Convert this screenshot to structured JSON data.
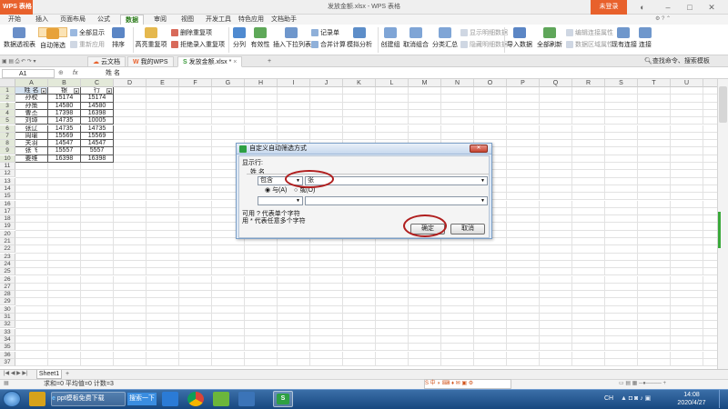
{
  "app": {
    "logo": "WPS 表格",
    "file_title": "发放金额.xlsx - WPS 表格",
    "login": "未登录"
  },
  "menu": [
    "开始",
    "插入",
    "页面布局",
    "公式",
    "数据",
    "审阅",
    "视图",
    "开发工具",
    "特色应用",
    "文档助手"
  ],
  "ribbon": {
    "pivot": "数据透视表",
    "autofilter": "自动筛选",
    "show_all": "全部显示",
    "reapply": "重新应用",
    "sort": "排序",
    "highlight_dup": "高亮重复项",
    "delete_dup": "删除重复项",
    "reject_dup": "拒绝录入重复项",
    "split": "分列",
    "validity": "有效性",
    "dropdown": "插入下拉列表",
    "record": "记录单",
    "merge_calc": "合并计算",
    "simulate": "模拟分析",
    "create_group": "创建组",
    "cancel_group": "取消组合",
    "subtotal": "分类汇总",
    "show_detail": "显示明细数据",
    "hide_detail": "隐藏明细数据",
    "import": "导入数据",
    "refresh_all": "全部刷新",
    "edit_link": "编辑连接属性",
    "data_region": "数据区域属性",
    "existing_conn": "现有连接",
    "connect": "连接"
  },
  "tabs": {
    "cloud": "云文档",
    "mywps": "我的WPS",
    "file": "发放金额.xlsx *",
    "search": "查找命令、搜索模板"
  },
  "formula": {
    "cell_ref": "A1",
    "fx": "fx",
    "value": "姓  名"
  },
  "columns": [
    "A",
    "B",
    "C",
    "D",
    "E",
    "F",
    "G",
    "H",
    "I",
    "J",
    "K",
    "L",
    "M",
    "N",
    "O",
    "P",
    "Q",
    "R",
    "S",
    "T",
    "U",
    "V"
  ],
  "rows": [
    "1",
    "2",
    "3",
    "4",
    "5",
    "6",
    "7",
    "8",
    "9",
    "10",
    "11",
    "12",
    "13",
    "14",
    "15",
    "16",
    "17",
    "18",
    "19",
    "20",
    "21",
    "22",
    "23",
    "24",
    "25",
    "26",
    "27",
    "28",
    "29",
    "30",
    "31",
    "32",
    "33",
    "34",
    "35",
    "36",
    "37"
  ],
  "table": {
    "headers": [
      "姓 名",
      "银",
      "行"
    ],
    "data": [
      [
        "孙权",
        "15174",
        "15174"
      ],
      [
        "孙策",
        "14580",
        "14580"
      ],
      [
        "曹丕",
        "17398",
        "16398"
      ],
      [
        "刘璋",
        "14735",
        "10005"
      ],
      [
        "张辽",
        "14735",
        "14735"
      ],
      [
        "周瑜",
        "15569",
        "15569"
      ],
      [
        "关羽",
        "14547",
        "14547"
      ],
      [
        "张飞",
        "15557",
        "5557"
      ],
      [
        "姜维",
        "16398",
        "16398"
      ]
    ]
  },
  "sheet": {
    "tab": "Sheet1",
    "status": "求和=0  平均值=0  计数=3"
  },
  "dialog": {
    "title": "自定义自动筛选方式",
    "show_rows": "显示行:",
    "field": "姓 名",
    "op1": "包含",
    "val1": "张",
    "and": "与(A)",
    "or": "或(O)",
    "op2": "",
    "val2": "",
    "hint1": "可用 ? 代表单个字符",
    "hint2": "用 * 代表任意多个字符",
    "ok": "确定",
    "cancel": "取消"
  },
  "taskbar": {
    "app1": "ppt模板免费下载",
    "search_btn": "搜索一下",
    "lang": "CH",
    "time": "14:08",
    "date": "2020/4/27"
  },
  "colors": {
    "wps_orange": "#e8612c",
    "data_tab_green": "#2f7d1e",
    "highlight_red": "#b01e1e"
  }
}
